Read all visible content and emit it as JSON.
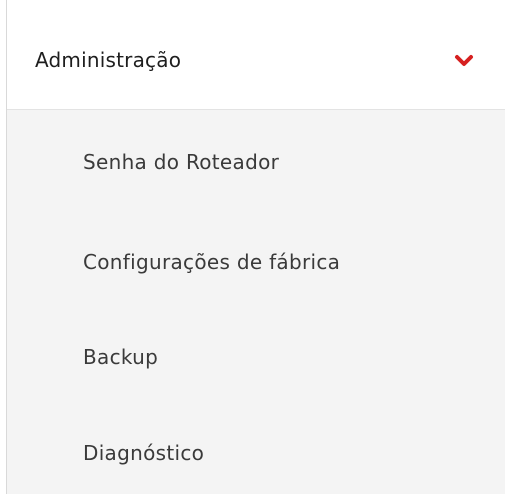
{
  "menu": {
    "section_label": "Administração",
    "expand_icon": "chevron-down-icon",
    "accent_color": "#d62020",
    "items": [
      {
        "label": "Senha do Roteador"
      },
      {
        "label": "Configurações de fábrica"
      },
      {
        "label": "Backup"
      },
      {
        "label": "Diagnóstico"
      }
    ]
  }
}
